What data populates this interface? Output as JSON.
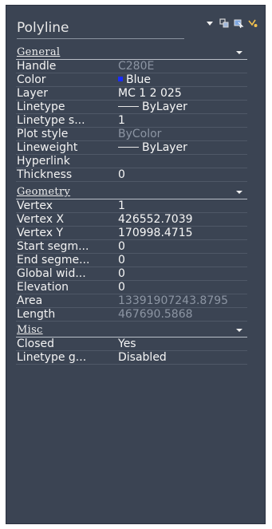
{
  "palette": {
    "object_type": "Polyline",
    "icons": [
      "dropdown-icon",
      "quick-select-icon",
      "select-objects-icon",
      "toggle-pickadd-icon"
    ]
  },
  "sections": {
    "general": {
      "title": "General",
      "rows": [
        {
          "label": "Handle",
          "value": "C280E"
        },
        {
          "label": "Color",
          "value": "Blue"
        },
        {
          "label": "Layer",
          "value": "MC 1 2 025"
        },
        {
          "label": "Linetype",
          "value": "ByLayer"
        },
        {
          "label": "Linetype s...",
          "value": "1"
        },
        {
          "label": "Plot style",
          "value": "ByColor"
        },
        {
          "label": "Lineweight",
          "value": "ByLayer"
        },
        {
          "label": "Hyperlink",
          "value": ""
        },
        {
          "label": "Thickness",
          "value": "0"
        }
      ]
    },
    "geometry": {
      "title": "Geometry",
      "rows": [
        {
          "label": "Vertex",
          "value": "1"
        },
        {
          "label": "Vertex X",
          "value": "426552.7039"
        },
        {
          "label": "Vertex Y",
          "value": "170998.4715"
        },
        {
          "label": "Start segm...",
          "value": "0"
        },
        {
          "label": "End segme...",
          "value": "0"
        },
        {
          "label": "Global wid...",
          "value": "0"
        },
        {
          "label": "Elevation",
          "value": "0"
        },
        {
          "label": "Area",
          "value": "13391907243.8795"
        },
        {
          "label": "Length",
          "value": "467690.5868"
        }
      ]
    },
    "misc": {
      "title": "Misc",
      "rows": [
        {
          "label": "Closed",
          "value": "Yes"
        },
        {
          "label": "Linetype g...",
          "value": "Disabled"
        }
      ]
    }
  },
  "colors": {
    "background": "#3b4453",
    "color_swatch": "#1a2cff",
    "dim_value": "#8c95a3"
  }
}
